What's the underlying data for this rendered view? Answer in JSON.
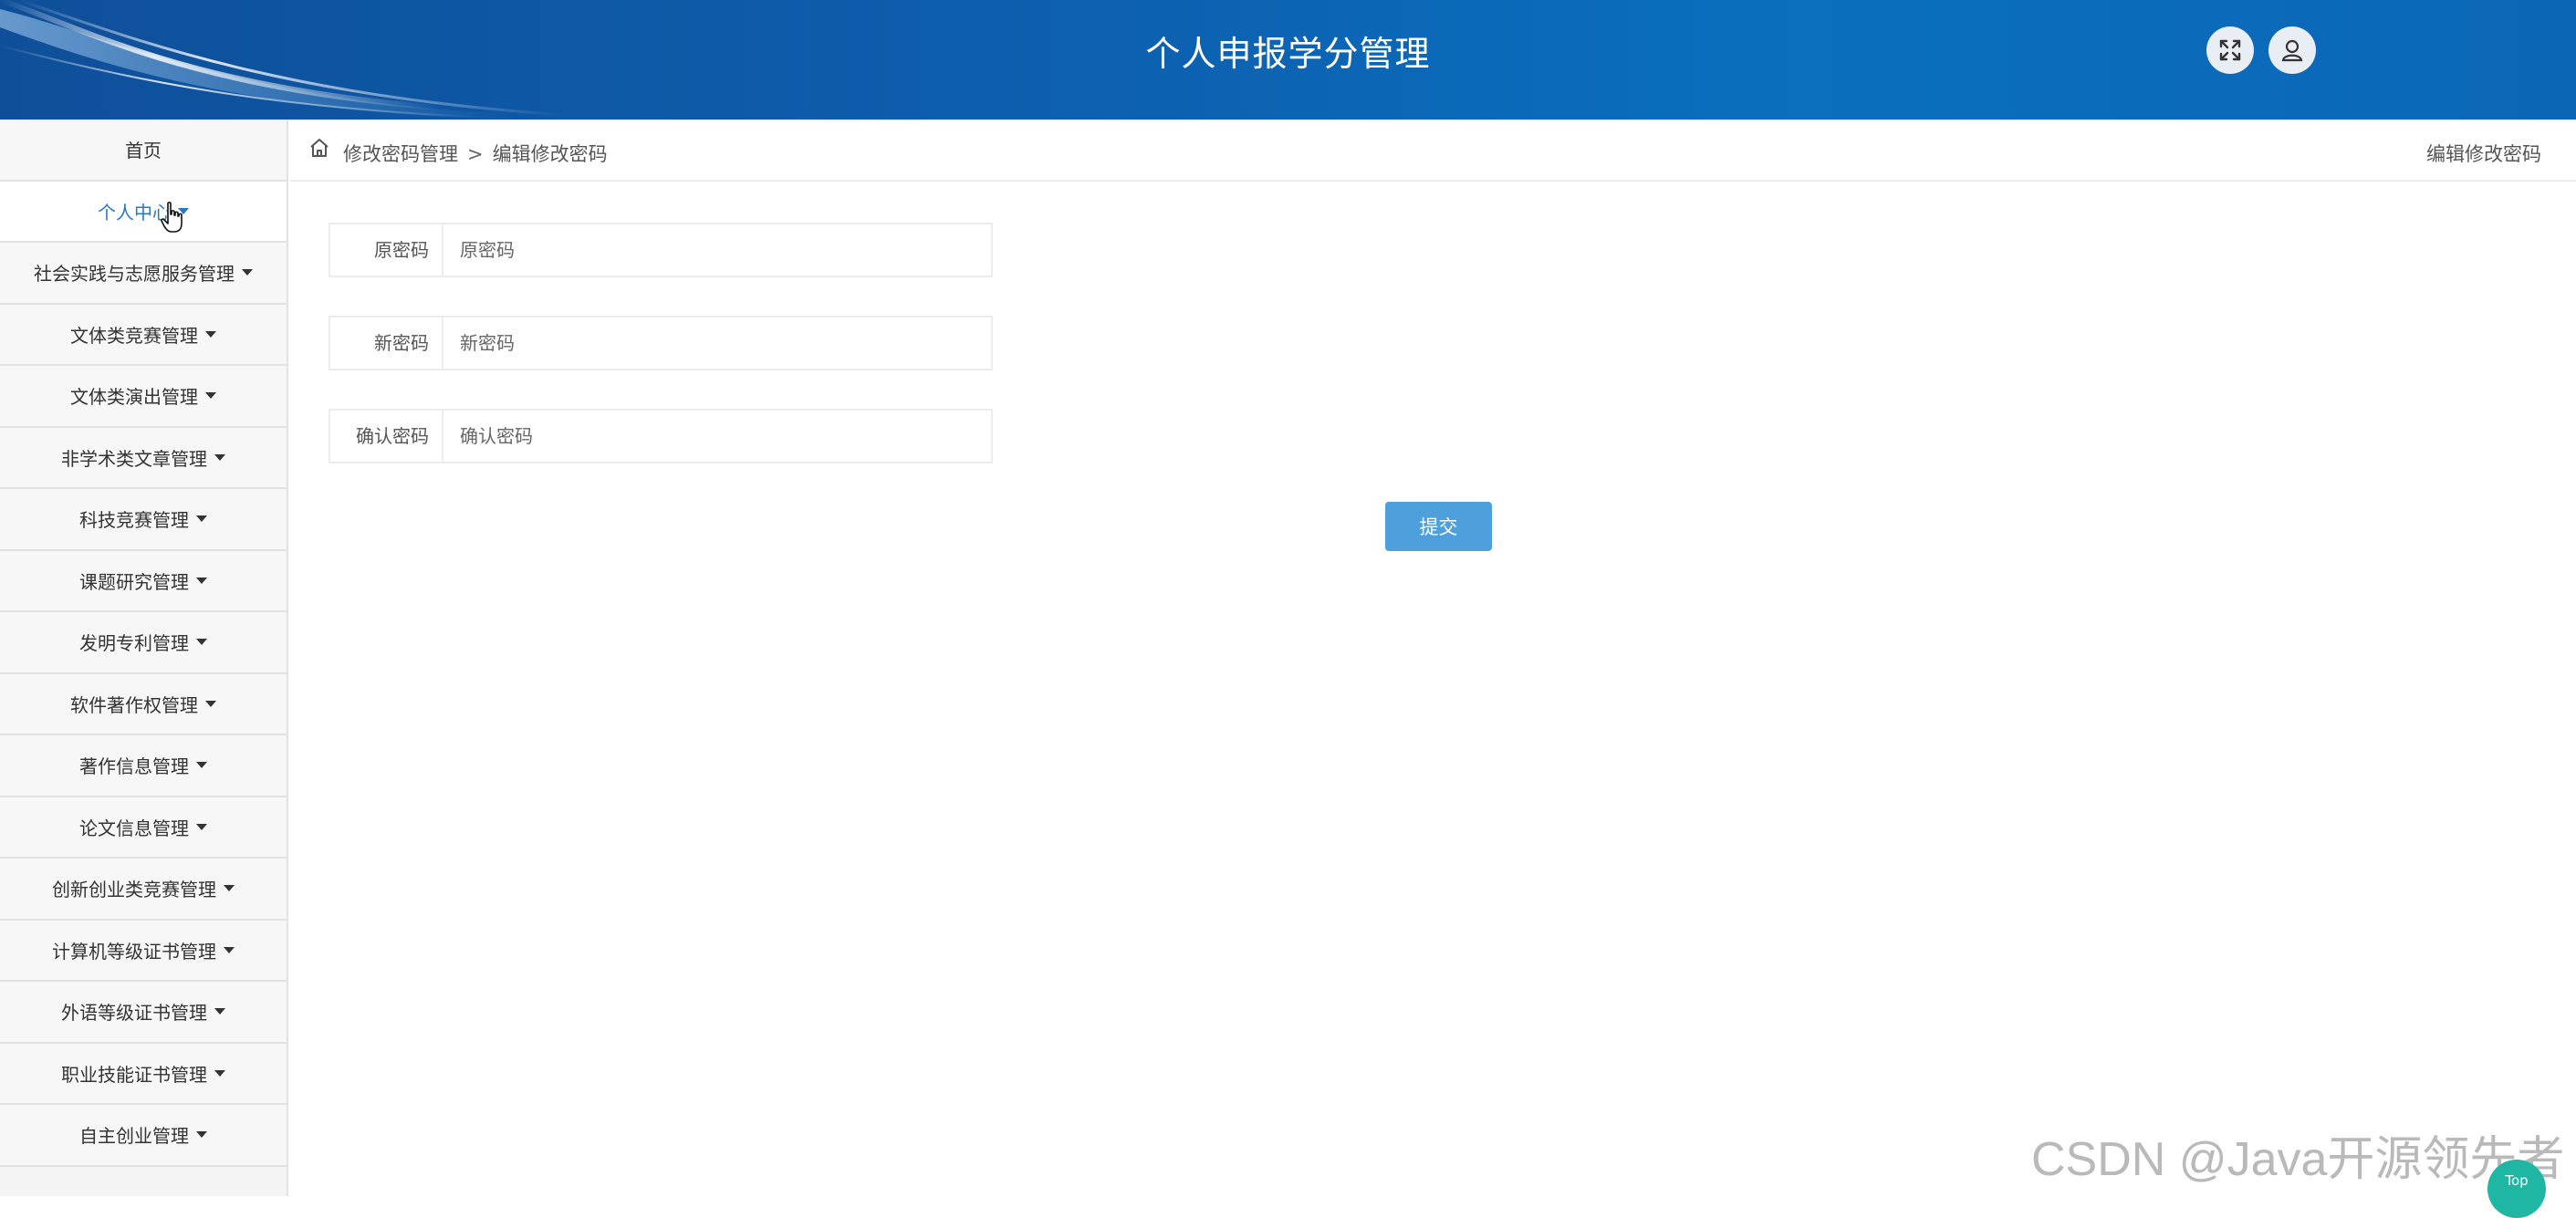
{
  "header": {
    "title": "个人申报学分管理",
    "fullscreen_icon": "expand-arrows-icon",
    "user_icon": "user-icon"
  },
  "sidebar": {
    "items": [
      {
        "label": "首页",
        "has_caret": false
      },
      {
        "label": "个人中心",
        "has_caret": true,
        "active": true
      },
      {
        "label": "社会实践与志愿服务管理",
        "has_caret": true
      },
      {
        "label": "文体类竞赛管理",
        "has_caret": true
      },
      {
        "label": "文体类演出管理",
        "has_caret": true
      },
      {
        "label": "非学术类文章管理",
        "has_caret": true
      },
      {
        "label": "科技竞赛管理",
        "has_caret": true
      },
      {
        "label": "课题研究管理",
        "has_caret": true
      },
      {
        "label": "发明专利管理",
        "has_caret": true
      },
      {
        "label": "软件著作权管理",
        "has_caret": true
      },
      {
        "label": "著作信息管理",
        "has_caret": true
      },
      {
        "label": "论文信息管理",
        "has_caret": true
      },
      {
        "label": "创新创业类竞赛管理",
        "has_caret": true
      },
      {
        "label": "计算机等级证书管理",
        "has_caret": true
      },
      {
        "label": "外语等级证书管理",
        "has_caret": true
      },
      {
        "label": "职业技能证书管理",
        "has_caret": true
      },
      {
        "label": "自主创业管理",
        "has_caret": true
      }
    ]
  },
  "breadcrumb": {
    "home_icon": "home-icon",
    "level1": "修改密码管理",
    "separator": ">",
    "level2": "编辑修改密码",
    "right_title": "编辑修改密码"
  },
  "form": {
    "old_password": {
      "label": "原密码",
      "placeholder": "原密码",
      "value": ""
    },
    "new_password": {
      "label": "新密码",
      "placeholder": "新密码",
      "value": ""
    },
    "confirm_password": {
      "label": "确认密码",
      "placeholder": "确认密码",
      "value": ""
    },
    "submit_label": "提交"
  },
  "watermark": "CSDN @Java开源领先者",
  "top_button_label": "Top",
  "colors": {
    "header": "#0d5fae",
    "accent": "#4ea0dc",
    "active_menu_text": "#2a78c2",
    "top_button": "#1fb6a4"
  }
}
